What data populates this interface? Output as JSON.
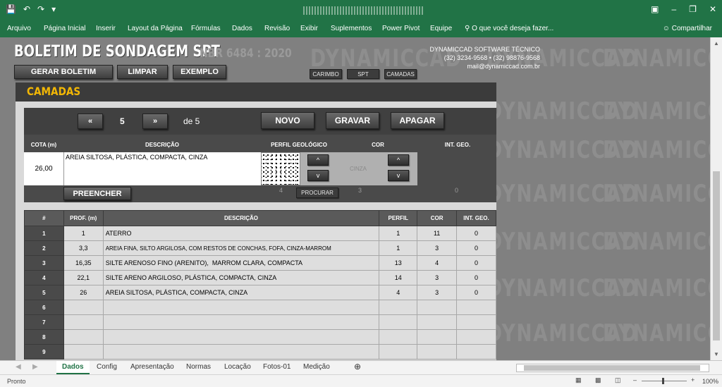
{
  "ribbon": {
    "tabs": [
      "Arquivo",
      "Página Inicial",
      "Inserir",
      "Layout da Página",
      "Fórmulas",
      "Dados",
      "Revisão",
      "Exibir",
      "Suplementos",
      "Power Pivot",
      "Equipe"
    ],
    "tell_me": "O que você deseja fazer...",
    "share": "Compartilhar"
  },
  "header": {
    "title": "BOLETIM DE SONDAGEM SPT",
    "norm": "NBR 6484 : 2020",
    "buttons": {
      "gerar": "GERAR BOLETIM",
      "limpar": "LIMPAR",
      "exemplo": "EXEMPLO"
    },
    "small_buttons": {
      "carimbo": "CARIMBO",
      "spt": "SPT",
      "camadas": "CAMADAS"
    },
    "contact": {
      "company": "DYNAMICCAD SOFTWARE TÉCNICO",
      "phones": "(32) 3234-9568 • (32) 98876-9568",
      "email": "mail@dynamiccad.com.br"
    }
  },
  "watermark": "DYNAMICCAD",
  "camadas": {
    "title": "CAMADAS",
    "nav": {
      "prev": "«",
      "current": "5",
      "next": "»",
      "of": "de 5",
      "novo": "NOVO",
      "gravar": "GRAVAR",
      "apagar": "APAGAR"
    },
    "columns": {
      "cota": "COTA (m)",
      "descricao": "DESCRIÇÃO",
      "perfil": "PERFIL GEOLÓGICO",
      "cor": "COR",
      "int": "INT. GEO."
    },
    "cota": "26,00",
    "descricao": "AREIA SILTOSA, PLÁSTICA, COMPACTA, CINZA",
    "cor_label": "CINZA",
    "arrows": {
      "up": "^",
      "down": "v"
    },
    "preencher": "PREENCHER",
    "procurar": "PROCURAR",
    "perfil_value": "4",
    "cor_value": "3",
    "int_value": "0"
  },
  "table": {
    "headers": [
      "#",
      "PROF. (m)",
      "DESCRIÇÃO",
      "PERFIL",
      "COR",
      "INT. GEO."
    ],
    "rows": [
      {
        "n": "1",
        "prof": "1",
        "desc": "ATERRO",
        "perfil": "1",
        "cor": "11",
        "int": "0"
      },
      {
        "n": "2",
        "prof": "3,3",
        "desc": "AREIA FINA, SILTO ARGILOSA, COM RESTOS DE CONCHAS, FOFA, CINZA-MARROM",
        "perfil": "1",
        "cor": "3",
        "int": "0"
      },
      {
        "n": "3",
        "prof": "16,35",
        "desc": "SILTE ARENOSO FINO (ARENITO),  MARROM CLARA, COMPACTA",
        "perfil": "13",
        "cor": "4",
        "int": "0"
      },
      {
        "n": "4",
        "prof": "22,1",
        "desc": "SILTE ARENO ARGILOSO, PLÁSTICA, COMPACTA, CINZA",
        "perfil": "14",
        "cor": "3",
        "int": "0"
      },
      {
        "n": "5",
        "prof": "26",
        "desc": "AREIA SILTOSA, PLÁSTICA, COMPACTA, CINZA",
        "perfil": "4",
        "cor": "3",
        "int": "0"
      },
      {
        "n": "6",
        "prof": "",
        "desc": "",
        "perfil": "",
        "cor": "",
        "int": ""
      },
      {
        "n": "7",
        "prof": "",
        "desc": "",
        "perfil": "",
        "cor": "",
        "int": ""
      },
      {
        "n": "8",
        "prof": "",
        "desc": "",
        "perfil": "",
        "cor": "",
        "int": ""
      },
      {
        "n": "9",
        "prof": "",
        "desc": "",
        "perfil": "",
        "cor": "",
        "int": ""
      }
    ]
  },
  "sheets": [
    "Dados",
    "Config",
    "Apresentação",
    "Normas",
    "Locação",
    "Fotos-01",
    "Medição"
  ],
  "status": {
    "ready": "Pronto",
    "zoom": "100%"
  },
  "colors": {
    "excel_green": "#217346",
    "title_yellow": "#f2b705"
  }
}
